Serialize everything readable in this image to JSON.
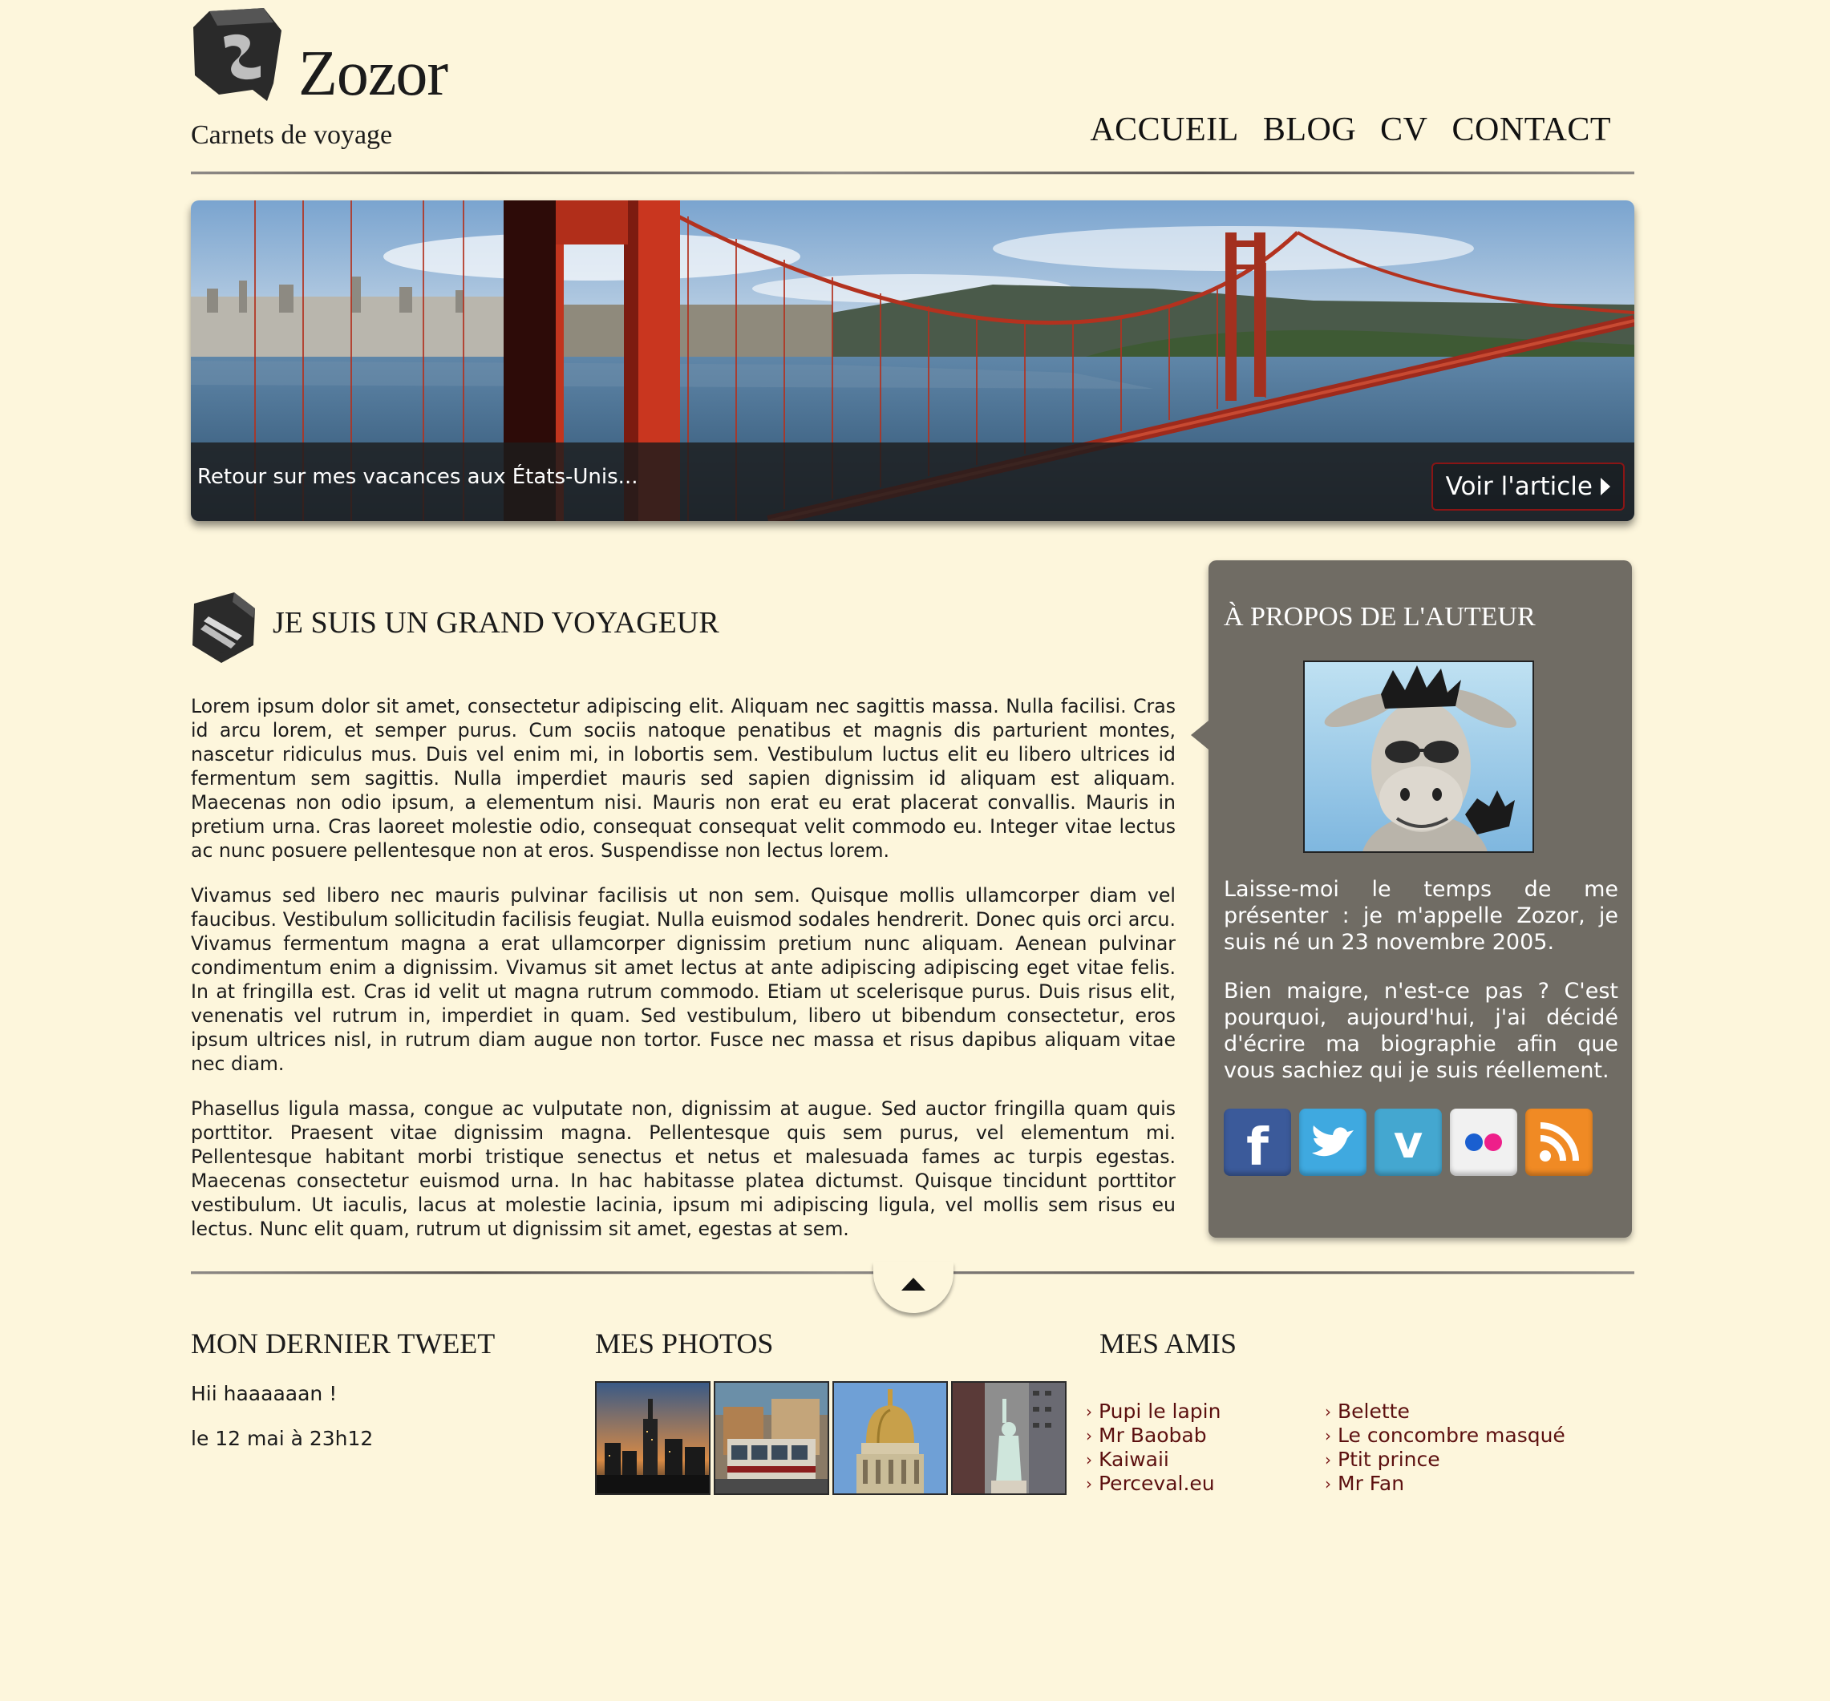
{
  "header": {
    "title": "Zozor",
    "subtitle": "Carnets de voyage",
    "logo_icon": "zozor-logo-icon",
    "nav": [
      {
        "label": "ACCUEIL"
      },
      {
        "label": "BLOG"
      },
      {
        "label": "CV"
      },
      {
        "label": "CONTACT"
      }
    ]
  },
  "banner": {
    "caption": "Retour sur mes vacances aux États-Unis...",
    "button_label": "Voir l'article"
  },
  "article": {
    "title": "JE SUIS UN GRAND VOYAGEUR",
    "paragraphs": [
      "Lorem ipsum dolor sit amet, consectetur adipiscing elit. Aliquam nec sagittis massa. Nulla facilisi. Cras id arcu lorem, et semper purus. Cum sociis natoque penatibus et magnis dis parturient montes, nascetur ridiculus mus. Duis vel enim mi, in lobortis sem. Vestibulum luctus elit eu libero ultrices id fermentum sem sagittis. Nulla imperdiet mauris sed sapien dignissim id aliquam est aliquam. Maecenas non odio ipsum, a elementum nisi. Mauris non erat eu erat placerat convallis. Mauris in pretium urna. Cras laoreet molestie odio, consequat consequat velit commodo eu. Integer vitae lectus ac nunc posuere pellentesque non at eros. Suspendisse non lectus lorem.",
      "Vivamus sed libero nec mauris pulvinar facilisis ut non sem. Quisque mollis ullamcorper diam vel faucibus. Vestibulum sollicitudin facilisis feugiat. Nulla euismod sodales hendrerit. Donec quis orci arcu. Vivamus fermentum magna a erat ullamcorper dignissim pretium nunc aliquam. Aenean pulvinar condimentum enim a dignissim. Vivamus sit amet lectus at ante adipiscing adipiscing eget vitae felis. In at fringilla est. Cras id velit ut magna rutrum commodo. Etiam ut scelerisque purus. Duis risus elit, venenatis vel rutrum in, imperdiet in quam. Sed vestibulum, libero ut bibendum consectetur, eros ipsum ultrices nisl, in rutrum diam augue non tortor. Fusce nec massa et risus dapibus aliquam vitae nec diam.",
      "Phasellus ligula massa, congue ac vulputate non, dignissim at augue. Sed auctor fringilla quam quis porttitor. Praesent vitae dignissim magna. Pellentesque quis sem purus, vel elementum mi. Pellentesque habitant morbi tristique senectus et netus et malesuada fames ac turpis egestas. Maecenas consectetur euismod urna. In hac habitasse platea dictumst. Quisque tincidunt porttitor vestibulum. Ut iaculis, lacus at molestie lacinia, ipsum mi adipiscing ligula, vel mollis sem risus eu lectus. Nunc elit quam, rutrum ut dignissim sit amet, egestas at sem."
    ]
  },
  "sidebar": {
    "title": "À PROPOS DE L'AUTEUR",
    "paragraphs": [
      "Laisse-moi le temps de me présenter : je m'appelle Zozor, je suis né un 23 novembre 2005.",
      "Bien maigre, n'est-ce pas ? C'est pourquoi, aujourd'hui, j'ai décidé d'écrire ma biographie afin que vous sachiez qui je suis réellement."
    ],
    "socials": [
      {
        "icon": "facebook-icon",
        "color": "#3b5a9a"
      },
      {
        "icon": "twitter-icon",
        "color": "#3fa9e0"
      },
      {
        "icon": "vimeo-icon",
        "color": "#44a7d0"
      },
      {
        "icon": "flickr-icon",
        "color": "#f1f1f1"
      },
      {
        "icon": "rss-icon",
        "color": "#f08a24"
      }
    ]
  },
  "footer": {
    "tweet": {
      "title": "MON DERNIER TWEET",
      "text": "Hii haaaaaan !",
      "date": "le 12 mai à 23h12"
    },
    "photos": {
      "title": "MES PHOTOS"
    },
    "friends": {
      "title": "MES AMIS",
      "col1": [
        "Pupi le lapin",
        "Mr Baobab",
        "Kaiwaii",
        "Perceval.eu"
      ],
      "col2": [
        "Belette",
        "Le concombre masqué",
        "Ptit prince",
        "Mr Fan"
      ]
    }
  },
  "colors": {
    "background": "#fdf6dc",
    "sidebar": "#706c64",
    "link": "#5c1010"
  }
}
